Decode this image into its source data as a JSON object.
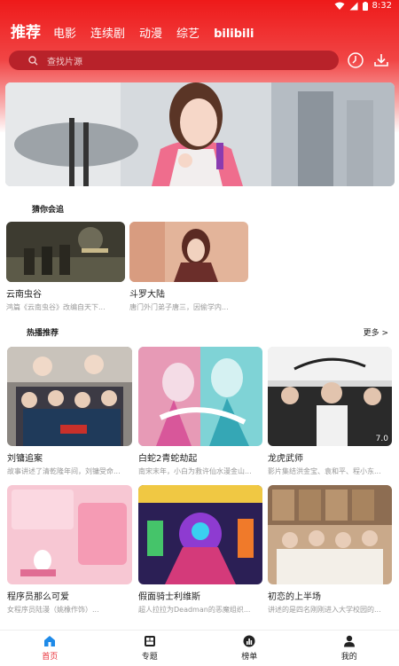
{
  "status_bar": {
    "time": "8:32"
  },
  "nav": {
    "tabs": [
      "推荐",
      "电影",
      "连续剧",
      "动漫",
      "综艺",
      "bilibili"
    ]
  },
  "search": {
    "placeholder": "查找片源"
  },
  "icons": {
    "search": "search-icon",
    "history": "clock-icon",
    "download": "download-icon",
    "home": "home-icon",
    "topic": "grid-icon",
    "rank": "chart-icon",
    "mine": "user-icon"
  },
  "colors": {
    "brand": "#e8313a",
    "header": "#ee1a1a"
  },
  "section_guess": {
    "title": "猜你会追",
    "items": [
      {
        "title": "云南虫谷",
        "desc": "鸿篇《云南虫谷》改编自天下..."
      },
      {
        "title": "斗罗大陆",
        "desc": "唐门外门弟子唐三，因偷学内..."
      }
    ]
  },
  "section_hot": {
    "title": "热播推荐",
    "more": "更多 >",
    "items": [
      {
        "title": "刘镛追案",
        "desc": "故事讲述了清乾隆年间，刘镛受命...",
        "badge": ""
      },
      {
        "title": "白蛇2青蛇劫起",
        "desc": "南宋末年，小白为救许仙水漫金山...",
        "badge": ""
      },
      {
        "title": "龙虎武师",
        "desc": "影片集结洪金宝、袁和平、程小东...",
        "badge": "7.0"
      },
      {
        "title": "程序员那么可爱",
        "desc": "女程序员陆漫（姚橡作饰）...",
        "badge": ""
      },
      {
        "title": "假面骑士利维斯",
        "desc": "超人拉拉为Deadman的恶魔组织...",
        "badge": ""
      },
      {
        "title": "初恋的上半场",
        "desc": "讲述的是四名刚刚进入大学校园的...",
        "badge": ""
      }
    ]
  },
  "bottom_nav": {
    "items": [
      {
        "label": "首页"
      },
      {
        "label": "专题"
      },
      {
        "label": "榜单"
      },
      {
        "label": "我的"
      }
    ]
  }
}
